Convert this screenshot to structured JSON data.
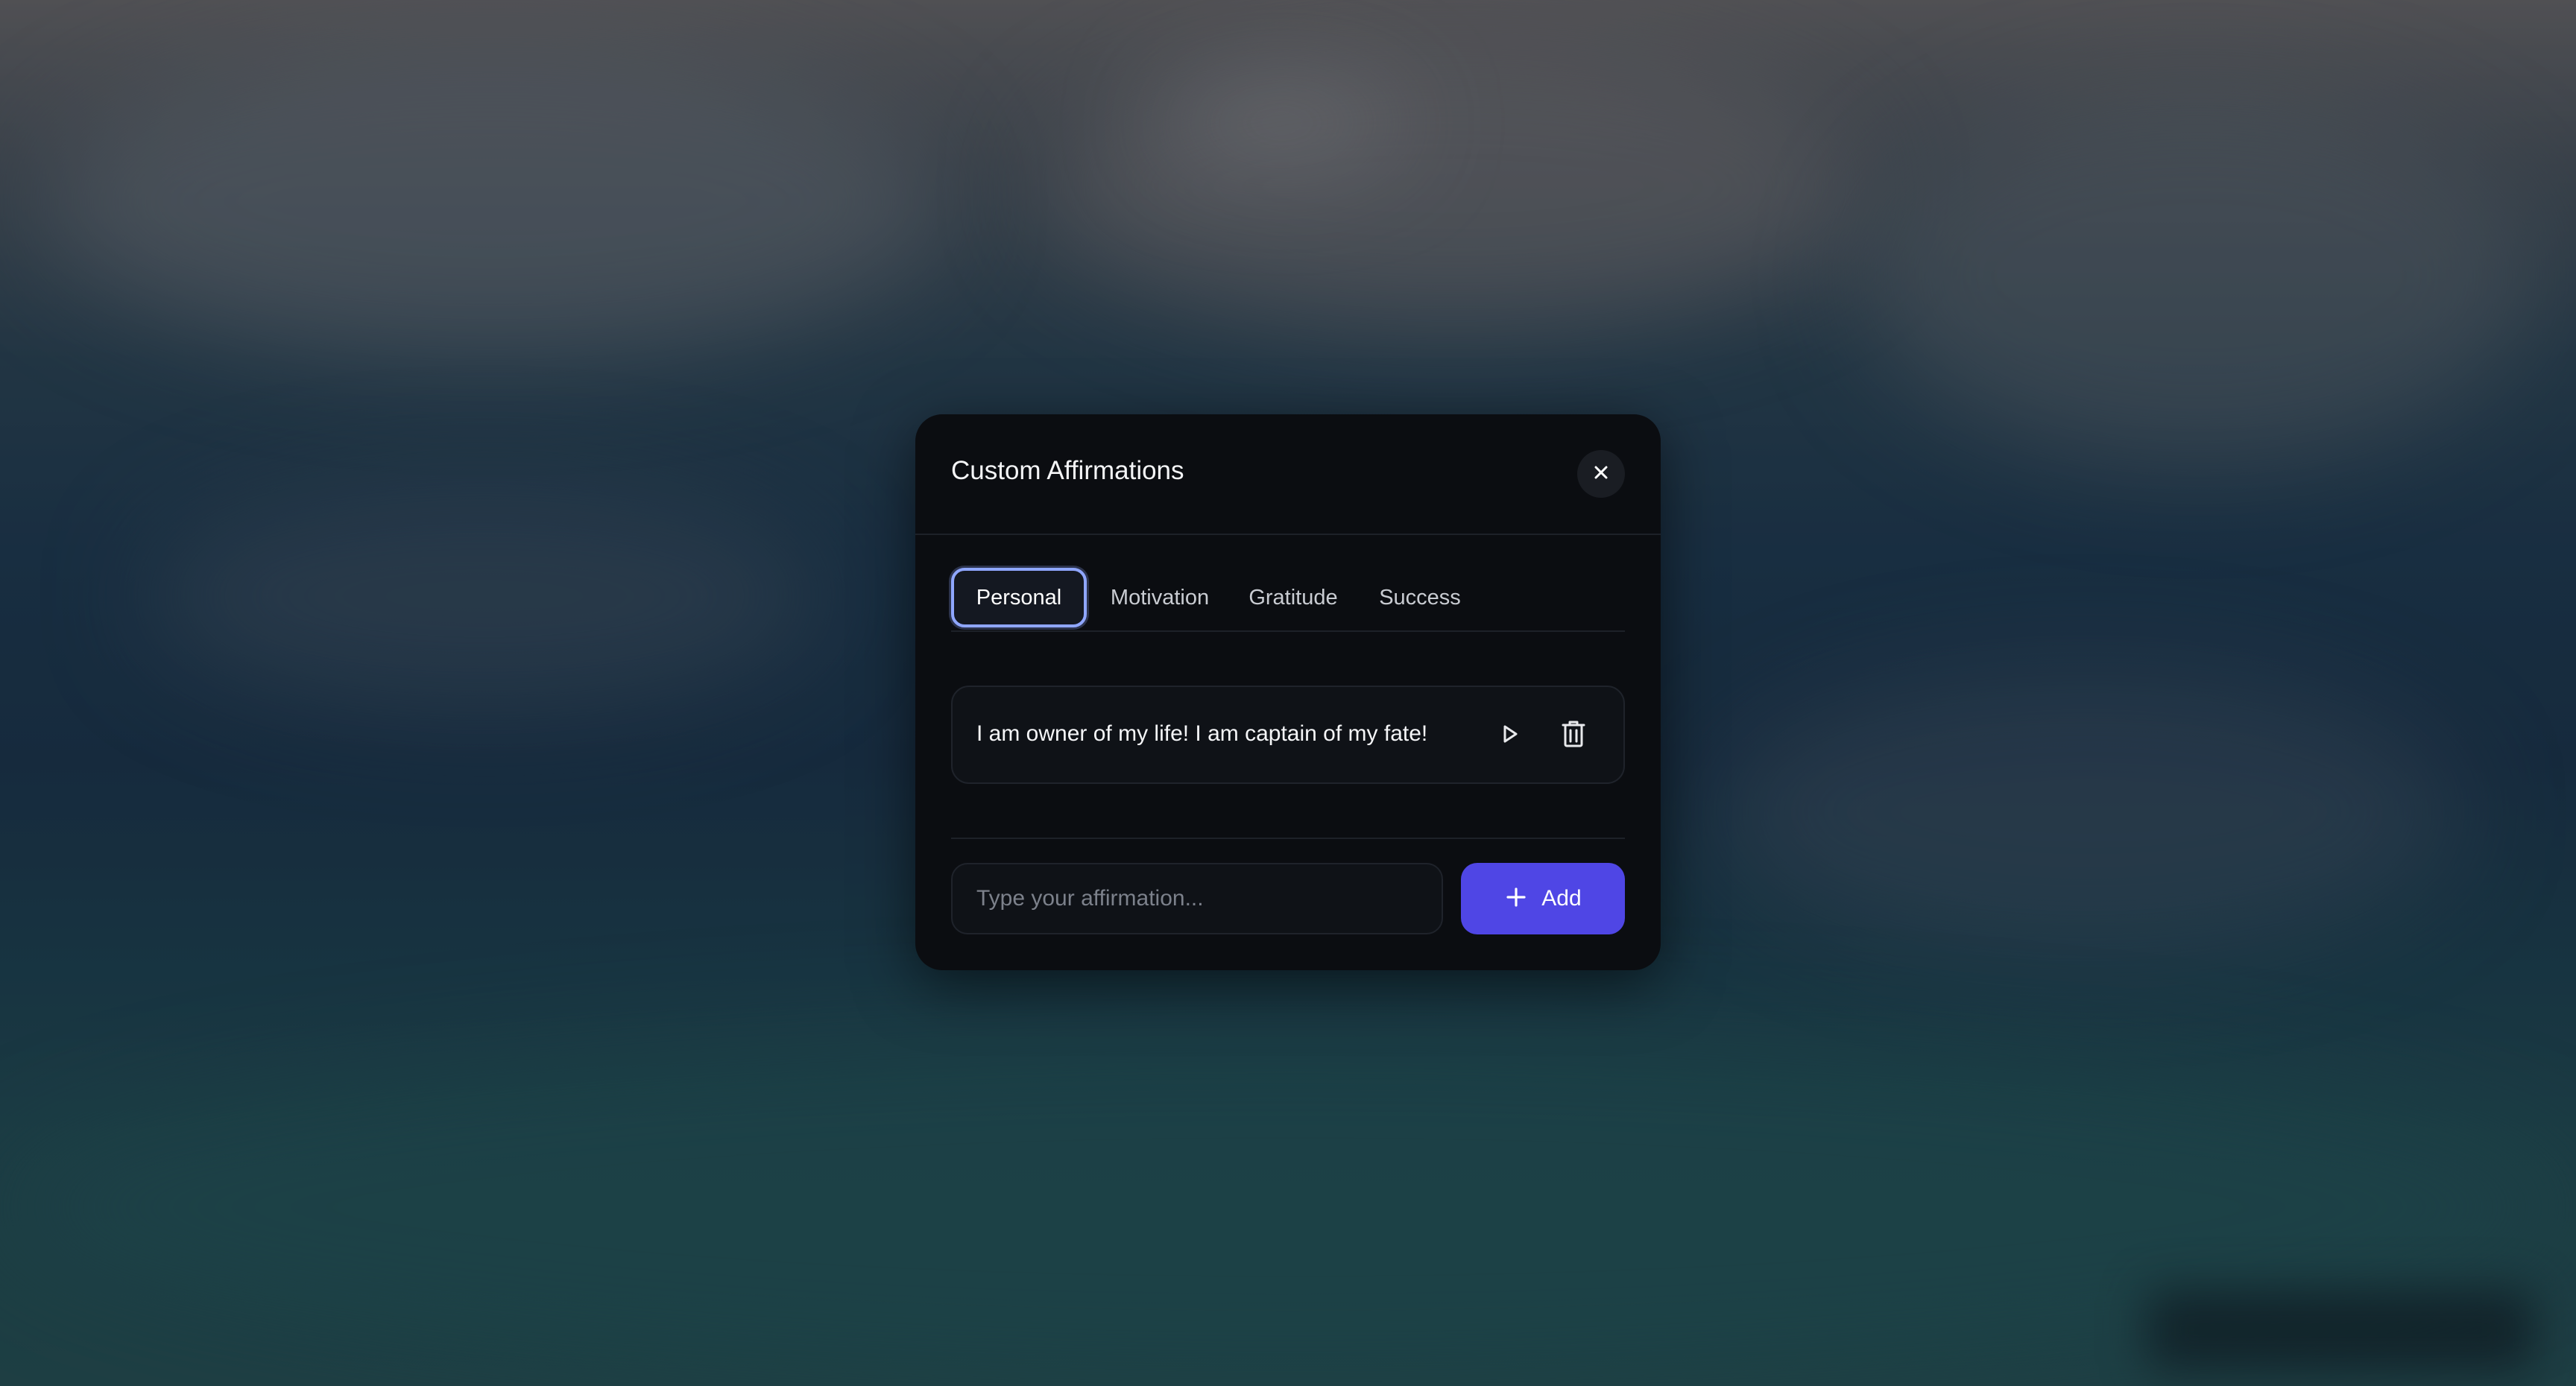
{
  "modal": {
    "title": "Custom Affirmations",
    "close_icon": "close-icon"
  },
  "tabs": [
    {
      "label": "Personal",
      "active": true
    },
    {
      "label": "Motivation",
      "active": false
    },
    {
      "label": "Gratitude",
      "active": false
    },
    {
      "label": "Success",
      "active": false
    }
  ],
  "affirmations": [
    {
      "text": "I am owner of my life! I am captain of my fate!",
      "play_icon": "play-icon",
      "delete_icon": "trash-icon"
    }
  ],
  "composer": {
    "placeholder": "Type your affirmation...",
    "add_label": "Add",
    "add_icon": "plus-icon"
  },
  "colors": {
    "accent": "#4f46e5",
    "active_tab_border": "#8fa6ff",
    "modal_bg": "#0b0d11"
  }
}
